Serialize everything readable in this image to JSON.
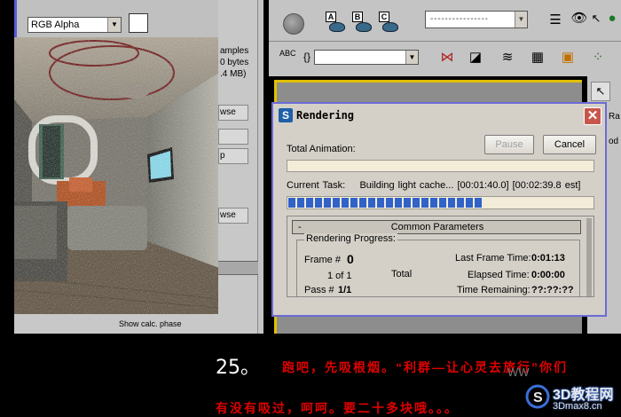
{
  "frame_buffer": {
    "channel_display": "RGB Alpha"
  },
  "render_setup_partial": {
    "text_samples": "amples",
    "text_bytes": "0 bytes",
    "text_mb": ".4 MB)",
    "browse1": "wse",
    "btn_p": "p",
    "browse2": "wse",
    "bottom_text": "Show calc. phase"
  },
  "toolbar": {
    "teapot_labels": [
      "A",
      "B",
      "C"
    ],
    "selection_set": "- - - - - - - - - - - - - - - -",
    "abc_label": "ABC",
    "cmd_partial": "Ra",
    "cmd_partial2": "od"
  },
  "dialog": {
    "title": "Rendering",
    "total_animation_label": "Total Animation:",
    "pause_label": "Pause",
    "cancel_label": "Cancel",
    "current_task_label": "Current Task:",
    "current_task_value": "Building light cache... [00:01:40.0] [00:02:39.8 est]",
    "current_task_progress": 0.64,
    "total_progress": 0,
    "rollout_minus": "-",
    "rollout_title": "Common Parameters",
    "group_title": "Rendering Progress:",
    "frame_label": "Frame #",
    "frame_value": "0",
    "frame_of": "1 of 1",
    "total_label": "Total",
    "pass_label": "Pass #",
    "pass_value": "1/1",
    "last_frame_label": "Last Frame Time:",
    "last_frame_value": "0:01:13",
    "elapsed_label": "Elapsed Time:",
    "elapsed_value": "0:00:00",
    "remaining_label": "Time Remaining:",
    "remaining_value": "??:??:??"
  },
  "caption": {
    "number": "25。",
    "line1": "跑吧，先吸根烟。“利群—让心灵去旅行”你们",
    "line2": "有没有吸过，呵呵。要二十多块哦。。。"
  },
  "watermark": {
    "left": "WW",
    "main": "3D教程网",
    "sub": "3Dmax8.cn"
  },
  "colors": {
    "accent_blue": "#3162c9",
    "dialog_border": "#6b6bd6",
    "caption_red": "#e00000",
    "viewport_highlight": "#e0c000"
  }
}
